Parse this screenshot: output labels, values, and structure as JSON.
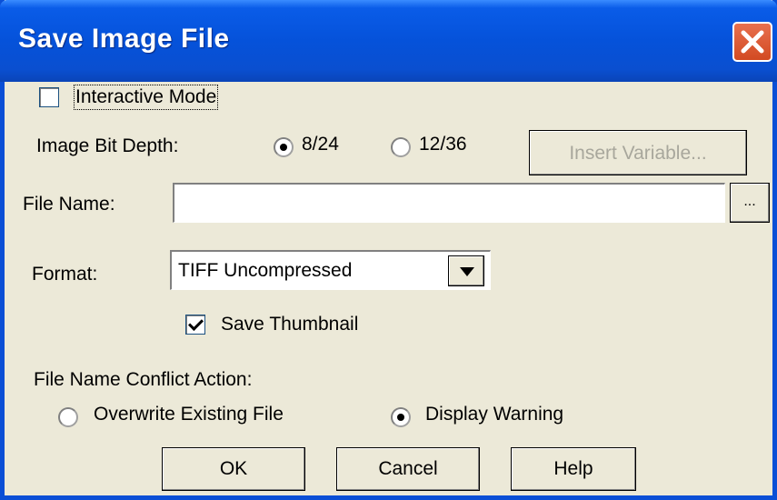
{
  "dialog": {
    "title": "Save Image File"
  },
  "interactive_mode": {
    "label": "Interactive Mode",
    "checked": false
  },
  "bit_depth": {
    "label": "Image Bit Depth:",
    "options": [
      {
        "label": "8/24",
        "selected": true
      },
      {
        "label": "12/36",
        "selected": false
      }
    ]
  },
  "insert_variable_label": "Insert Variable...",
  "file_name": {
    "label": "File Name:",
    "value": "",
    "browse_label": "..."
  },
  "format": {
    "label": "Format:",
    "selected": "TIFF Uncompressed"
  },
  "save_thumbnail": {
    "label": "Save Thumbnail",
    "checked": true
  },
  "conflict": {
    "label": "File Name Conflict Action:",
    "options": [
      {
        "label": "Overwrite Existing File",
        "selected": false
      },
      {
        "label": "Display Warning",
        "selected": true
      }
    ]
  },
  "buttons": {
    "ok": "OK",
    "cancel": "Cancel",
    "help": "Help"
  },
  "colors": {
    "titlebar": "#0552da",
    "face": "#ece9d8",
    "close": "#d24a22"
  }
}
